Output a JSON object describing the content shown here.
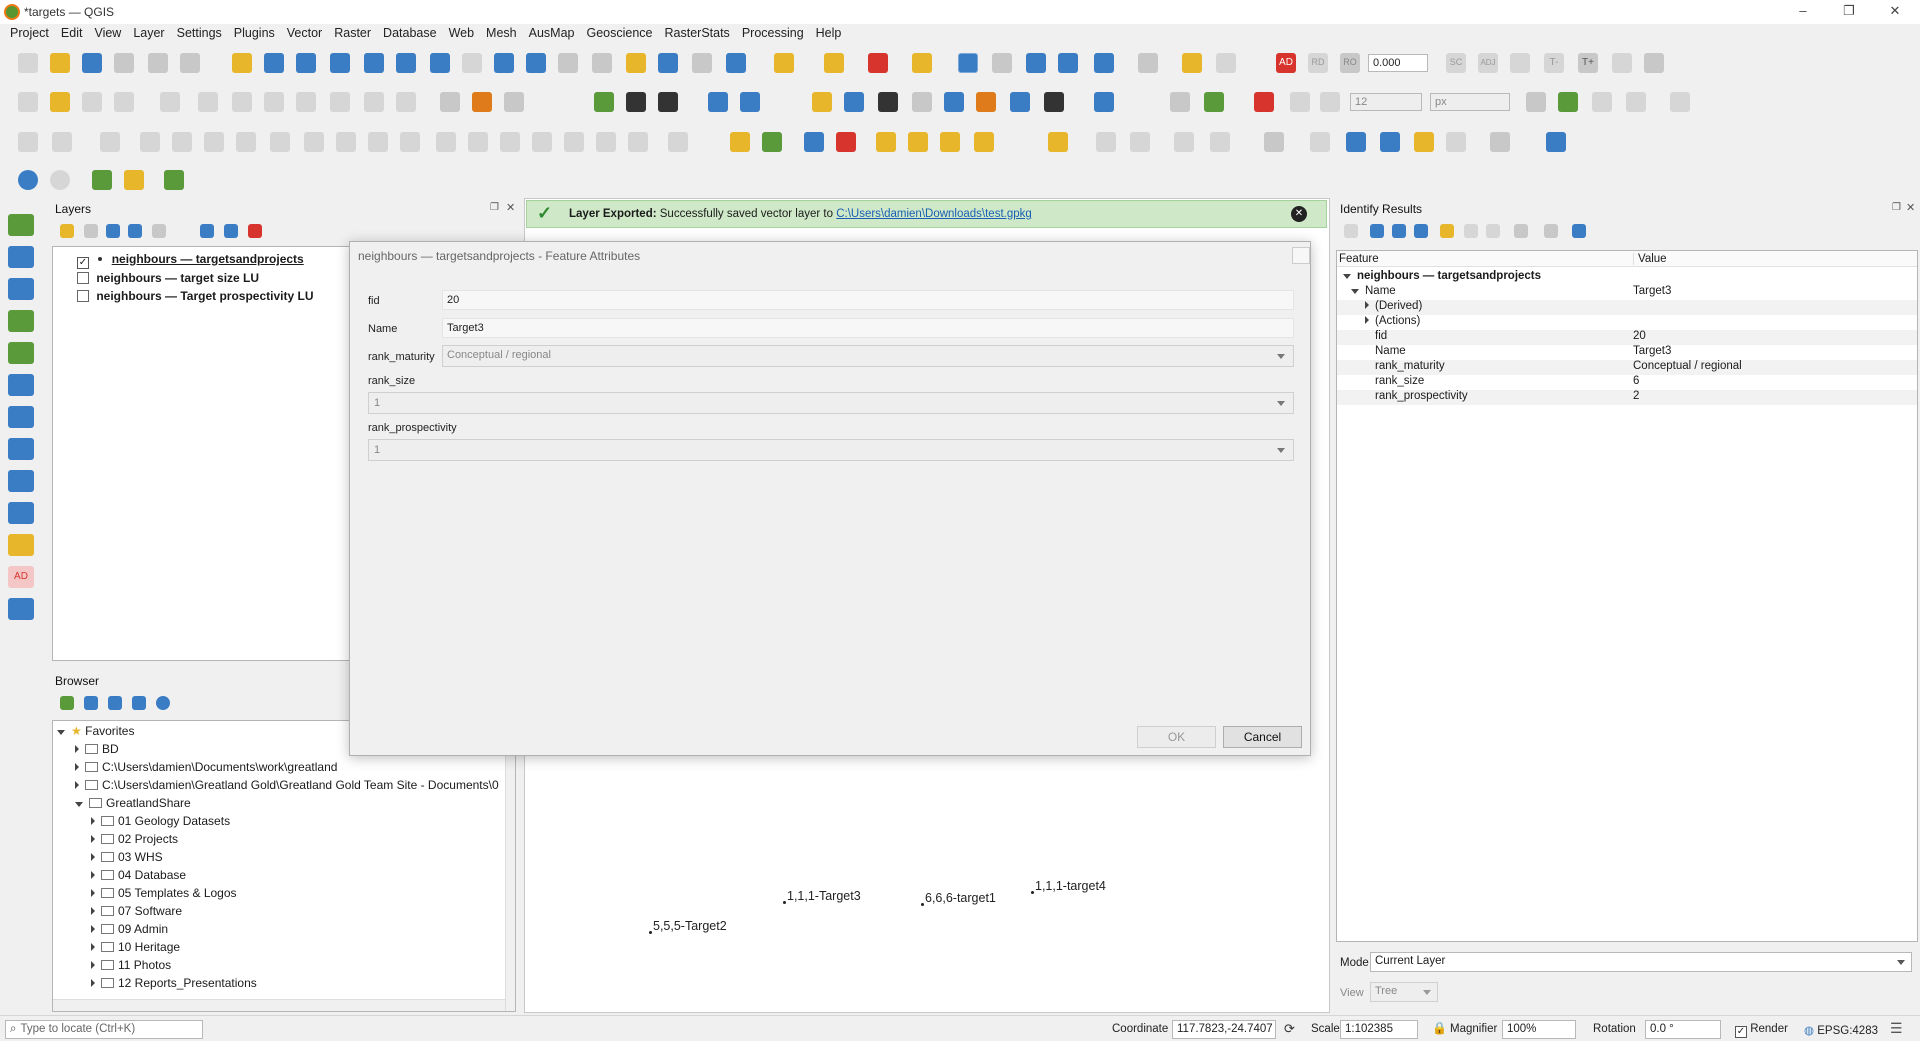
{
  "window": {
    "title": "*targets — QGIS",
    "minimize": "–",
    "restore": "❐",
    "close": "✕"
  },
  "menu": [
    "Project",
    "Edit",
    "View",
    "Layer",
    "Settings",
    "Plugins",
    "Vector",
    "Raster",
    "Database",
    "Web",
    "Mesh",
    "AusMap",
    "Geoscience",
    "RasterStats",
    "Processing",
    "Help"
  ],
  "toolbar": {
    "label_ad": "AD",
    "label_rd": "RD",
    "label_ro": "RO",
    "rotation_value": "0.000",
    "label_sc": "SC",
    "label_adj": "ADJ",
    "label_t": "T-",
    "label_tplus": "T+",
    "font_size_value": "12",
    "unit_value": "px"
  },
  "layers_panel": {
    "title": "Layers",
    "items": [
      {
        "label": "neighbours — targetsandprojects",
        "checked": "✓"
      },
      {
        "label": "neighbours — target size LU"
      },
      {
        "label": "neighbours — Target prospectivity LU"
      }
    ]
  },
  "browser_panel": {
    "title": "Browser",
    "items": [
      {
        "label": "Favorites",
        "level": 0
      },
      {
        "label": "BD",
        "level": 1
      },
      {
        "label": "C:\\Users\\damien\\Documents\\work\\greatland",
        "level": 1
      },
      {
        "label": "C:\\Users\\damien\\Greatland Gold\\Greatland Gold Team Site - Documents\\0",
        "level": 1
      },
      {
        "label": "GreatlandShare",
        "level": 1
      },
      {
        "label": "01 Geology Datasets",
        "level": 2
      },
      {
        "label": "02 Projects",
        "level": 2
      },
      {
        "label": "03 WHS",
        "level": 2
      },
      {
        "label": "04 Database",
        "level": 2
      },
      {
        "label": "05 Templates & Logos",
        "level": 2
      },
      {
        "label": "07 Software",
        "level": 2
      },
      {
        "label": "09 Admin",
        "level": 2
      },
      {
        "label": "10 Heritage",
        "level": 2
      },
      {
        "label": "11 Photos",
        "level": 2
      },
      {
        "label": "12 Reports_Presentations",
        "level": 2
      }
    ]
  },
  "message_bar": {
    "title": "Layer Exported:",
    "text": "Successfully saved vector layer to",
    "link": "C:\\Users\\damien\\Downloads\\test.gpkg"
  },
  "dialog": {
    "title": "neighbours — targetsandprojects - Feature Attributes",
    "fid_label": "fid",
    "fid_value": "20",
    "name_label": "Name",
    "name_value": "Target3",
    "rank_maturity_label": "rank_maturity",
    "rank_maturity_value": "Conceptual / regional",
    "rank_size_label": "rank_size",
    "rank_size_value": "1",
    "rank_prospectivity_label": "rank_prospectivity",
    "rank_prospectivity_value": "1",
    "ok": "OK",
    "cancel": "Cancel"
  },
  "map_labels": [
    "1,1,1-Target3",
    "6,6,6-target1",
    "1,1,1-target4",
    "5,5,5-Target2"
  ],
  "identify": {
    "title": "Identify Results",
    "col_feature": "Feature",
    "col_value": "Value",
    "layer": "neighbours — targetsandprojects",
    "rows": [
      {
        "key": "Name",
        "value": "Target3"
      },
      {
        "key": "(Derived)",
        "value": ""
      },
      {
        "key": "(Actions)",
        "value": ""
      },
      {
        "key": "fid",
        "value": "20"
      },
      {
        "key": "Name",
        "value": "Target3"
      },
      {
        "key": "rank_maturity",
        "value": "Conceptual / regional"
      },
      {
        "key": "rank_size",
        "value": "6"
      },
      {
        "key": "rank_prospectivity",
        "value": "2"
      }
    ],
    "mode_label": "Mode",
    "mode_value": "Current Layer",
    "view_label": "View",
    "view_value": "Tree"
  },
  "status": {
    "locate_placeholder": "Type to locate (Ctrl+K)",
    "coordinate_label": "Coordinate",
    "coordinate_value": "117.7823,-24.7407",
    "scale_label": "Scale",
    "scale_value": "1:102385",
    "magnifier_label": "Magnifier",
    "magnifier_value": "100%",
    "rotation_label": "Rotation",
    "rotation_value": "0.0 °",
    "render_label": "Render",
    "render_check": "✓",
    "crs": "EPSG:4283"
  },
  "colors": {
    "accent_green": "#589632",
    "message_bg": "#cfe9c8",
    "link": "#1a5fb4"
  }
}
